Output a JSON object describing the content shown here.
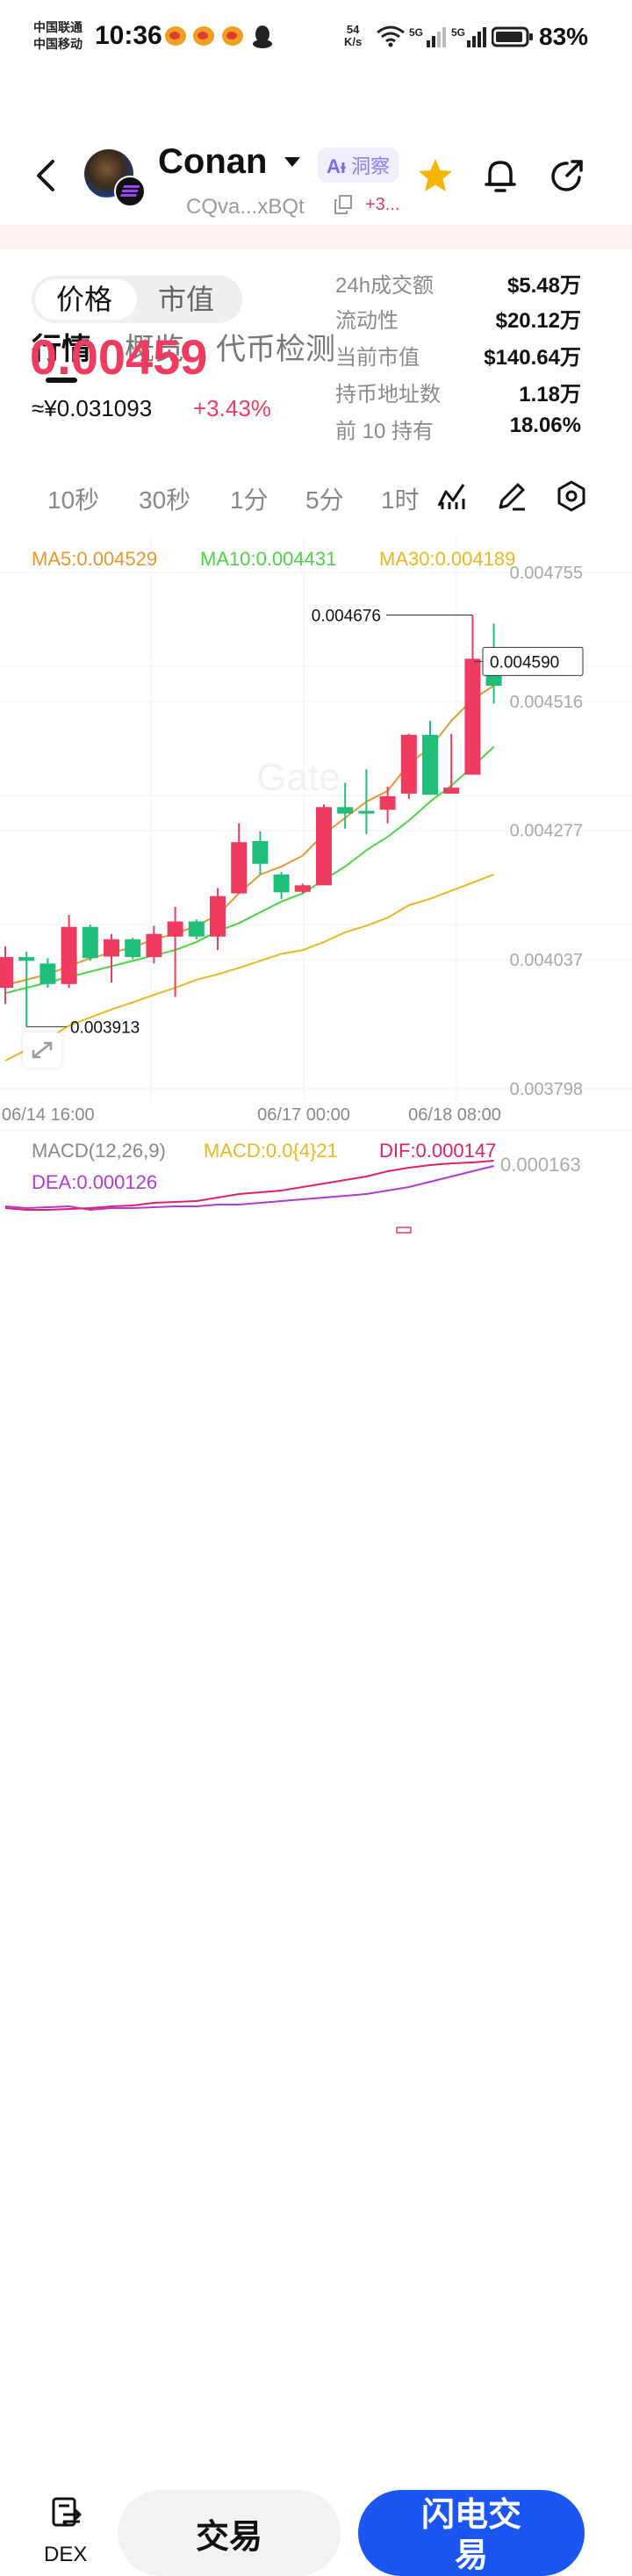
{
  "status_bar": {
    "carrier_1": "中国联通",
    "carrier_2": "中国移动",
    "time": "10:36",
    "net_speed_value": "54",
    "net_speed_unit": "K/s",
    "signal_1": "5G",
    "signal_2": "5G",
    "battery": "83%",
    "icons": [
      "weibo-icon",
      "weibo-icon",
      "weibo-icon",
      "qq-icon",
      "wifi-icon",
      "signal-icon",
      "signal-icon",
      "battery-icon"
    ]
  },
  "header": {
    "token_name": "Conan",
    "ai_prefix": "Aᵻ",
    "ai_label": "洞察",
    "address": "CQva...xBQt",
    "address_more": "+3..."
  },
  "tabs": [
    {
      "label": "行情",
      "active": true
    },
    {
      "label": "概览",
      "active": false
    },
    {
      "label": "代币检测",
      "active": false
    }
  ],
  "price_panel": {
    "toggle": [
      "价格",
      "市值"
    ],
    "price": "0.00459",
    "cny_price": "≈¥0.031093",
    "change": "+3.43%"
  },
  "stats": [
    {
      "label": "24h成交额",
      "value": "$5.48万"
    },
    {
      "label": "流动性",
      "value": "$20.12万"
    },
    {
      "label": "当前市值",
      "value": "$140.64万"
    },
    {
      "label": "持币地址数",
      "value": "1.18万"
    },
    {
      "label": "前 10 持有",
      "value": "18.06%"
    }
  ],
  "intervals": [
    "10秒",
    "30秒",
    "1分",
    "5分",
    "1时"
  ],
  "colors": {
    "up": "#ee3b5f",
    "down": "#1fbf7a",
    "ma5": "#e8962e",
    "ma10": "#4cd442",
    "ma30": "#e8b820",
    "dea": "#b13ad6",
    "dif": "#e0206a",
    "primary": "#1b55f2"
  },
  "chart_data": {
    "type": "candlestick",
    "ma_labels": [
      "MA5:0.004529",
      "MA10:0.004431",
      "MA30:0.004189"
    ],
    "y_ticks": [
      "0.004755",
      "0.004516",
      "0.004277",
      "0.004037",
      "0.003798"
    ],
    "x_ticks": [
      "06/14 16:00",
      "06/17 00:00",
      "06/18 08:00"
    ],
    "last_price_label": "0.004590",
    "high_label": "0.004676",
    "low_label": "0.003913",
    "candles": [
      {
        "o": 0.003985,
        "c": 0.004042,
        "h": 0.004062,
        "l": 0.003955
      },
      {
        "o": 0.004042,
        "c": 0.004035,
        "h": 0.004052,
        "l": 0.003913
      },
      {
        "o": 0.00403,
        "c": 0.003992,
        "h": 0.00404,
        "l": 0.003985
      },
      {
        "o": 0.003992,
        "c": 0.004098,
        "h": 0.00412,
        "l": 0.003985
      },
      {
        "o": 0.004098,
        "c": 0.00404,
        "h": 0.004102,
        "l": 0.004035
      },
      {
        "o": 0.004043,
        "c": 0.004075,
        "h": 0.004085,
        "l": 0.003995
      },
      {
        "o": 0.004075,
        "c": 0.004042,
        "h": 0.004078,
        "l": 0.004038
      },
      {
        "o": 0.004042,
        "c": 0.004085,
        "h": 0.0041,
        "l": 0.00403
      },
      {
        "o": 0.00408,
        "c": 0.004108,
        "h": 0.004135,
        "l": 0.003968
      },
      {
        "o": 0.004108,
        "c": 0.00408,
        "h": 0.004112,
        "l": 0.004075
      },
      {
        "o": 0.00408,
        "c": 0.004155,
        "h": 0.00417,
        "l": 0.004055
      },
      {
        "o": 0.00416,
        "c": 0.004255,
        "h": 0.00429,
        "l": 0.00416
      },
      {
        "o": 0.004257,
        "c": 0.004215,
        "h": 0.004275,
        "l": 0.004195
      },
      {
        "o": 0.004195,
        "c": 0.004162,
        "h": 0.0042,
        "l": 0.00415
      },
      {
        "o": 0.004163,
        "c": 0.004175,
        "h": 0.004178,
        "l": 0.00416
      },
      {
        "o": 0.004175,
        "c": 0.00432,
        "h": 0.004325,
        "l": 0.004175
      },
      {
        "o": 0.00432,
        "c": 0.004308,
        "h": 0.004365,
        "l": 0.00428
      },
      {
        "o": 0.004313,
        "c": 0.004308,
        "h": 0.00439,
        "l": 0.00427
      },
      {
        "o": 0.004315,
        "c": 0.00434,
        "h": 0.004358,
        "l": 0.00429
      },
      {
        "o": 0.004345,
        "c": 0.004454,
        "h": 0.004456,
        "l": 0.004335
      },
      {
        "o": 0.004454,
        "c": 0.004343,
        "h": 0.00448,
        "l": 0.004343
      },
      {
        "o": 0.004345,
        "c": 0.004356,
        "h": 0.004456,
        "l": 0.004345
      },
      {
        "o": 0.00438,
        "c": 0.004595,
        "h": 0.004676,
        "l": 0.00438
      },
      {
        "o": 0.00459,
        "c": 0.004545,
        "h": 0.00466,
        "l": 0.004512
      }
    ],
    "ma5": [
      0.00399,
      0.004,
      0.00401,
      0.004025,
      0.00404,
      0.00405,
      0.00406,
      0.004075,
      0.004085,
      0.0041,
      0.00412,
      0.00416,
      0.004195,
      0.00421,
      0.00423,
      0.00427,
      0.0043,
      0.00433,
      0.00435,
      0.0044,
      0.00443,
      0.00448,
      0.00452,
      0.004545
    ],
    "ma10": [
      0.003975,
      0.003985,
      0.003995,
      0.004005,
      0.004015,
      0.004025,
      0.004035,
      0.004045,
      0.004055,
      0.00407,
      0.00409,
      0.004105,
      0.004125,
      0.004145,
      0.00416,
      0.004185,
      0.00421,
      0.00424,
      0.004265,
      0.004295,
      0.00433,
      0.00436,
      0.004395,
      0.004432
    ],
    "ma30": [
      0.00385,
      0.00387,
      0.00389,
      0.003915,
      0.00393,
      0.003945,
      0.003958,
      0.003972,
      0.003985,
      0.004,
      0.00401,
      0.004022,
      0.004035,
      0.004048,
      0.004055,
      0.00407,
      0.004088,
      0.0041,
      0.004115,
      0.004138,
      0.00415,
      0.004165,
      0.00418,
      0.004195
    ]
  },
  "macd": {
    "title": "MACD(12,26,9)",
    "macd_label": "MACD:0.0{4}21",
    "dif_label": "DIF:0.000147",
    "dea_label": "DEA:0.000126",
    "y_tick": "0.000163"
  },
  "bottom": {
    "dex_label": "DEX",
    "trade_label": "交易",
    "flash_label_1": "闪电交",
    "flash_label_2": "易"
  }
}
